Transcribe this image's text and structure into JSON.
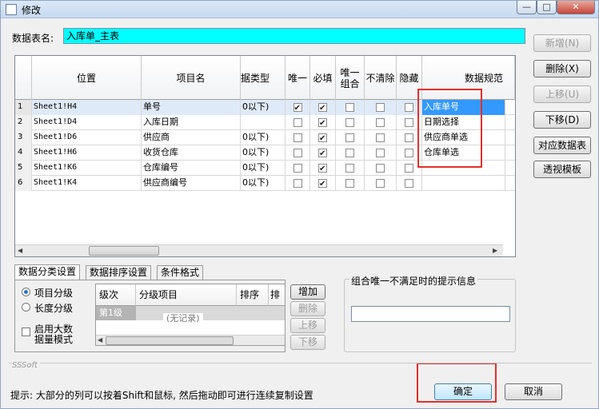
{
  "window": {
    "title": "修改",
    "min_glyph": "—",
    "max_glyph": "□",
    "close_glyph": "✕"
  },
  "table_name": {
    "label": "数据表名:",
    "value": "入库单_主表"
  },
  "side_buttons": {
    "add": "新增(N)",
    "delete": "删除(X)",
    "move_up": "上移(U)",
    "move_down": "下移(D)",
    "map_table": "对应数据表",
    "pivot_template": "透视模板"
  },
  "grid": {
    "headers": {
      "position": "位置",
      "item_name": "项目名",
      "data_type": "据类型",
      "unique": "唯一",
      "required": "必填",
      "unique_combo_line1": "唯一",
      "unique_combo_line2": "组合",
      "no_clear": "不清除",
      "hidden": "隐藏",
      "data_spec": "数据规范"
    },
    "rows": [
      {
        "num": "1",
        "pos": "Sheet1!H4",
        "name": "单号",
        "type": "0以下)",
        "unique": true,
        "required": true,
        "combo": false,
        "noclear": false,
        "hidden": false,
        "spec": "入库单号"
      },
      {
        "num": "2",
        "pos": "Sheet1!D4",
        "name": "入库日期",
        "type": "",
        "unique": false,
        "required": true,
        "combo": false,
        "noclear": false,
        "hidden": false,
        "spec": "日期选择"
      },
      {
        "num": "3",
        "pos": "Sheet1!D6",
        "name": "供应商",
        "type": "0以下)",
        "unique": false,
        "required": true,
        "combo": false,
        "noclear": false,
        "hidden": false,
        "spec": "供应商单选"
      },
      {
        "num": "4",
        "pos": "Sheet1!H6",
        "name": "收货仓库",
        "type": "0以下)",
        "unique": false,
        "required": true,
        "combo": false,
        "noclear": false,
        "hidden": false,
        "spec": "仓库单选"
      },
      {
        "num": "5",
        "pos": "Sheet1!K6",
        "name": "仓库编号",
        "type": "0以下)",
        "unique": false,
        "required": true,
        "combo": false,
        "noclear": false,
        "hidden": false,
        "spec": ""
      },
      {
        "num": "6",
        "pos": "Sheet1!K4",
        "name": "供应商编号",
        "type": "0以下)",
        "unique": false,
        "required": true,
        "combo": false,
        "noclear": false,
        "hidden": false,
        "spec": ""
      }
    ]
  },
  "tabs": [
    "数据分类设置",
    "数据排序设置",
    "条件格式"
  ],
  "classify": {
    "radio_item": "项目分级",
    "radio_length": "长度分级",
    "bigdata_line1": "启用大数",
    "bigdata_line2": "据量模式",
    "subgrid_headers": [
      "级次",
      "分级项目",
      "排序",
      "排序"
    ],
    "first_level": "第1级",
    "no_records": "(无记录)",
    "btn_add": "增加",
    "btn_delete": "删除",
    "btn_up": "上移",
    "btn_down": "下移"
  },
  "combo_hint": {
    "title": "组合唯一不满足时的提示信息",
    "value": ""
  },
  "footer": {
    "brand": "SSSoft",
    "hint": "提示: 大部分的列可以按着Shift和鼠标, 然后拖动即可进行连续复制设置",
    "ok": "确定",
    "cancel": "取消"
  },
  "colors": {
    "table_name_bg": "#00ffff",
    "highlight_box": "#e4302a",
    "selection": "#3399ff"
  }
}
